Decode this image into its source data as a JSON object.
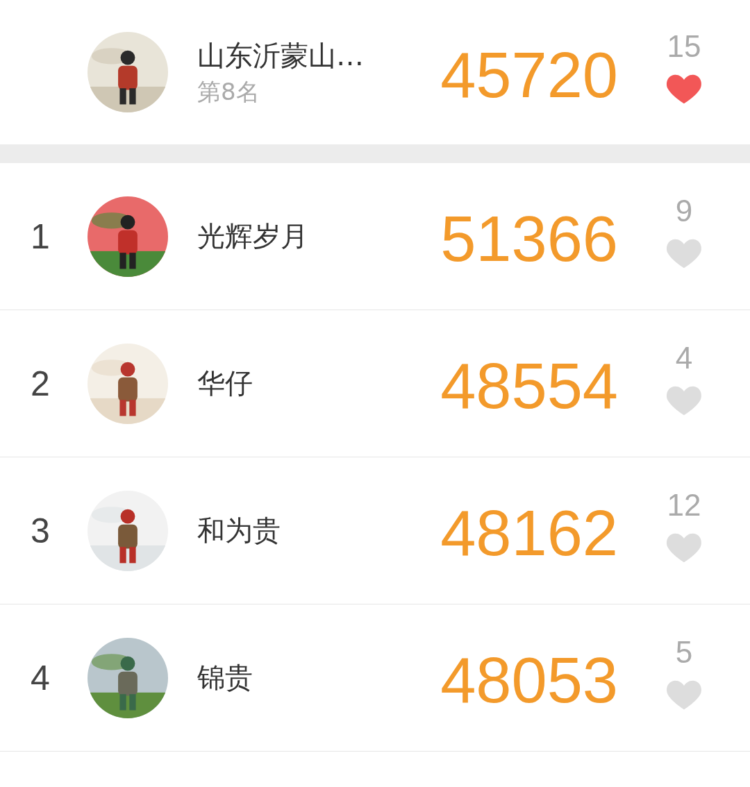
{
  "my_entry": {
    "name": "山东沂蒙山…",
    "place": "第8名",
    "score": "45720",
    "likes": "15",
    "liked": true
  },
  "ranking": [
    {
      "rank": "1",
      "name": "光辉岁月",
      "score": "51366",
      "likes": "9",
      "liked": false
    },
    {
      "rank": "2",
      "name": "华仔",
      "score": "48554",
      "likes": "4",
      "liked": false
    },
    {
      "rank": "3",
      "name": "和为贵",
      "score": "48162",
      "likes": "12",
      "liked": false
    },
    {
      "rank": "4",
      "name": "锦贵",
      "score": "48053",
      "likes": "5",
      "liked": false
    }
  ]
}
